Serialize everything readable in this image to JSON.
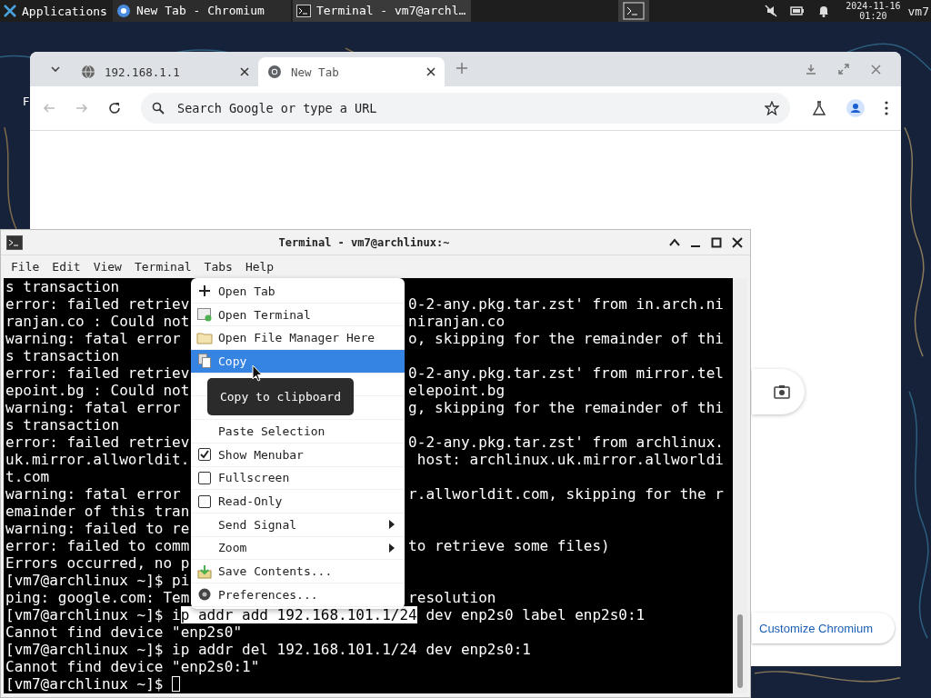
{
  "panel": {
    "apps_label": "Applications",
    "tasks": [
      {
        "label": "New Tab - Chromium",
        "kind": "browser",
        "selected": false
      },
      {
        "label": "Terminal - vm7@archl…",
        "kind": "terminal",
        "selected": true
      }
    ],
    "date": "2024-11-16",
    "time": "01:20",
    "user": "vm7"
  },
  "desktop_label": "F",
  "browser": {
    "tabs": [
      {
        "label": "192.168.1.1",
        "kind": "globe",
        "selected": false
      },
      {
        "label": "New Tab",
        "kind": "chromium",
        "selected": true
      }
    ],
    "address": {
      "placeholder": "Search Google or type a URL"
    },
    "customize_button": "Customize Chromium"
  },
  "terminal": {
    "title": "Terminal - vm7@archlinux:~",
    "menus": [
      "File",
      "Edit",
      "View",
      "Terminal",
      "Tabs",
      "Help"
    ],
    "lines": [
      {
        "left": "s transaction"
      },
      {
        "left": "error: failed retriev",
        "right": "0-2-any.pkg.tar.zst' from in.arch.ni"
      },
      {
        "left": "ranjan.co : Could not",
        "right": "niranjan.co"
      },
      {
        "left": "warning: fatal error",
        "right": "o, skipping for the remainder of thi"
      },
      {
        "left": "s transaction"
      },
      {
        "left": "error: failed retriev",
        "right": "0-2-any.pkg.tar.zst' from mirror.tel"
      },
      {
        "left": "epoint.bg : Could not",
        "right": "elepoint.bg"
      },
      {
        "left": "warning: fatal error",
        "right": "g, skipping for the remainder of thi"
      },
      {
        "left": "s transaction"
      },
      {
        "left": "error: failed retriev",
        "right": "0-2-any.pkg.tar.zst' from archlinux."
      },
      {
        "left": "uk.mirror.allworldit.",
        "right": " host: archlinux.uk.mirror.allworldi"
      },
      {
        "left": "t.com"
      },
      {
        "left": "warning: fatal error",
        "right": "r.allworldit.com, skipping for the r"
      },
      {
        "left": "emainder of this tran"
      },
      {
        "left": "warning: failed to re"
      },
      {
        "left": "error: failed to comm",
        "right": "to retrieve some files)"
      },
      {
        "left": "Errors occurred, no p"
      },
      {
        "left": "[vm7@archlinux ~]$ pi"
      },
      {
        "left": "ping: google.com: Tem",
        "right": "resolution"
      },
      {
        "left": "[vm7@archlinux ~]$ i",
        "selection": "p addr add 192.168.101.1/24",
        "after": " dev enp2s0 label enp2s0:1"
      },
      {
        "left": "Cannot find device \"enp2s0\""
      },
      {
        "left": "[vm7@archlinux ~]$ ip addr del 192.168.101.1/24 dev enp2s0:1"
      },
      {
        "left": "Cannot find device \"enp2s0:1\""
      },
      {
        "left": "[vm7@archlinux ~]$",
        "cursor": true
      }
    ]
  },
  "context_menu": {
    "items": [
      {
        "kind": "plus",
        "label": "Open Tab",
        "selected": false
      },
      {
        "kind": "terminal",
        "label": "Open Terminal",
        "selected": false
      },
      {
        "kind": "folder",
        "label": "Open File Manager Here",
        "selected": false
      },
      {
        "kind": "copy",
        "label": "Copy",
        "selected": true
      },
      {
        "kind": "covered"
      },
      {
        "kind": "covered"
      },
      {
        "kind": "plain",
        "label": "Paste Selection",
        "selected": false
      },
      {
        "kind": "check",
        "label": "Show Menubar",
        "checked": true,
        "selected": false
      },
      {
        "kind": "check",
        "label": "Fullscreen",
        "checked": false,
        "selected": false
      },
      {
        "kind": "check",
        "label": "Read-Only",
        "checked": false,
        "selected": false
      },
      {
        "kind": "submenu",
        "label": "Send Signal",
        "selected": false
      },
      {
        "kind": "submenu",
        "label": "Zoom",
        "selected": false
      },
      {
        "kind": "save",
        "label": "Save Contents...",
        "selected": false
      },
      {
        "kind": "gear",
        "label": "Preferences...",
        "selected": false
      }
    ],
    "tooltip": "Copy to clipboard"
  }
}
